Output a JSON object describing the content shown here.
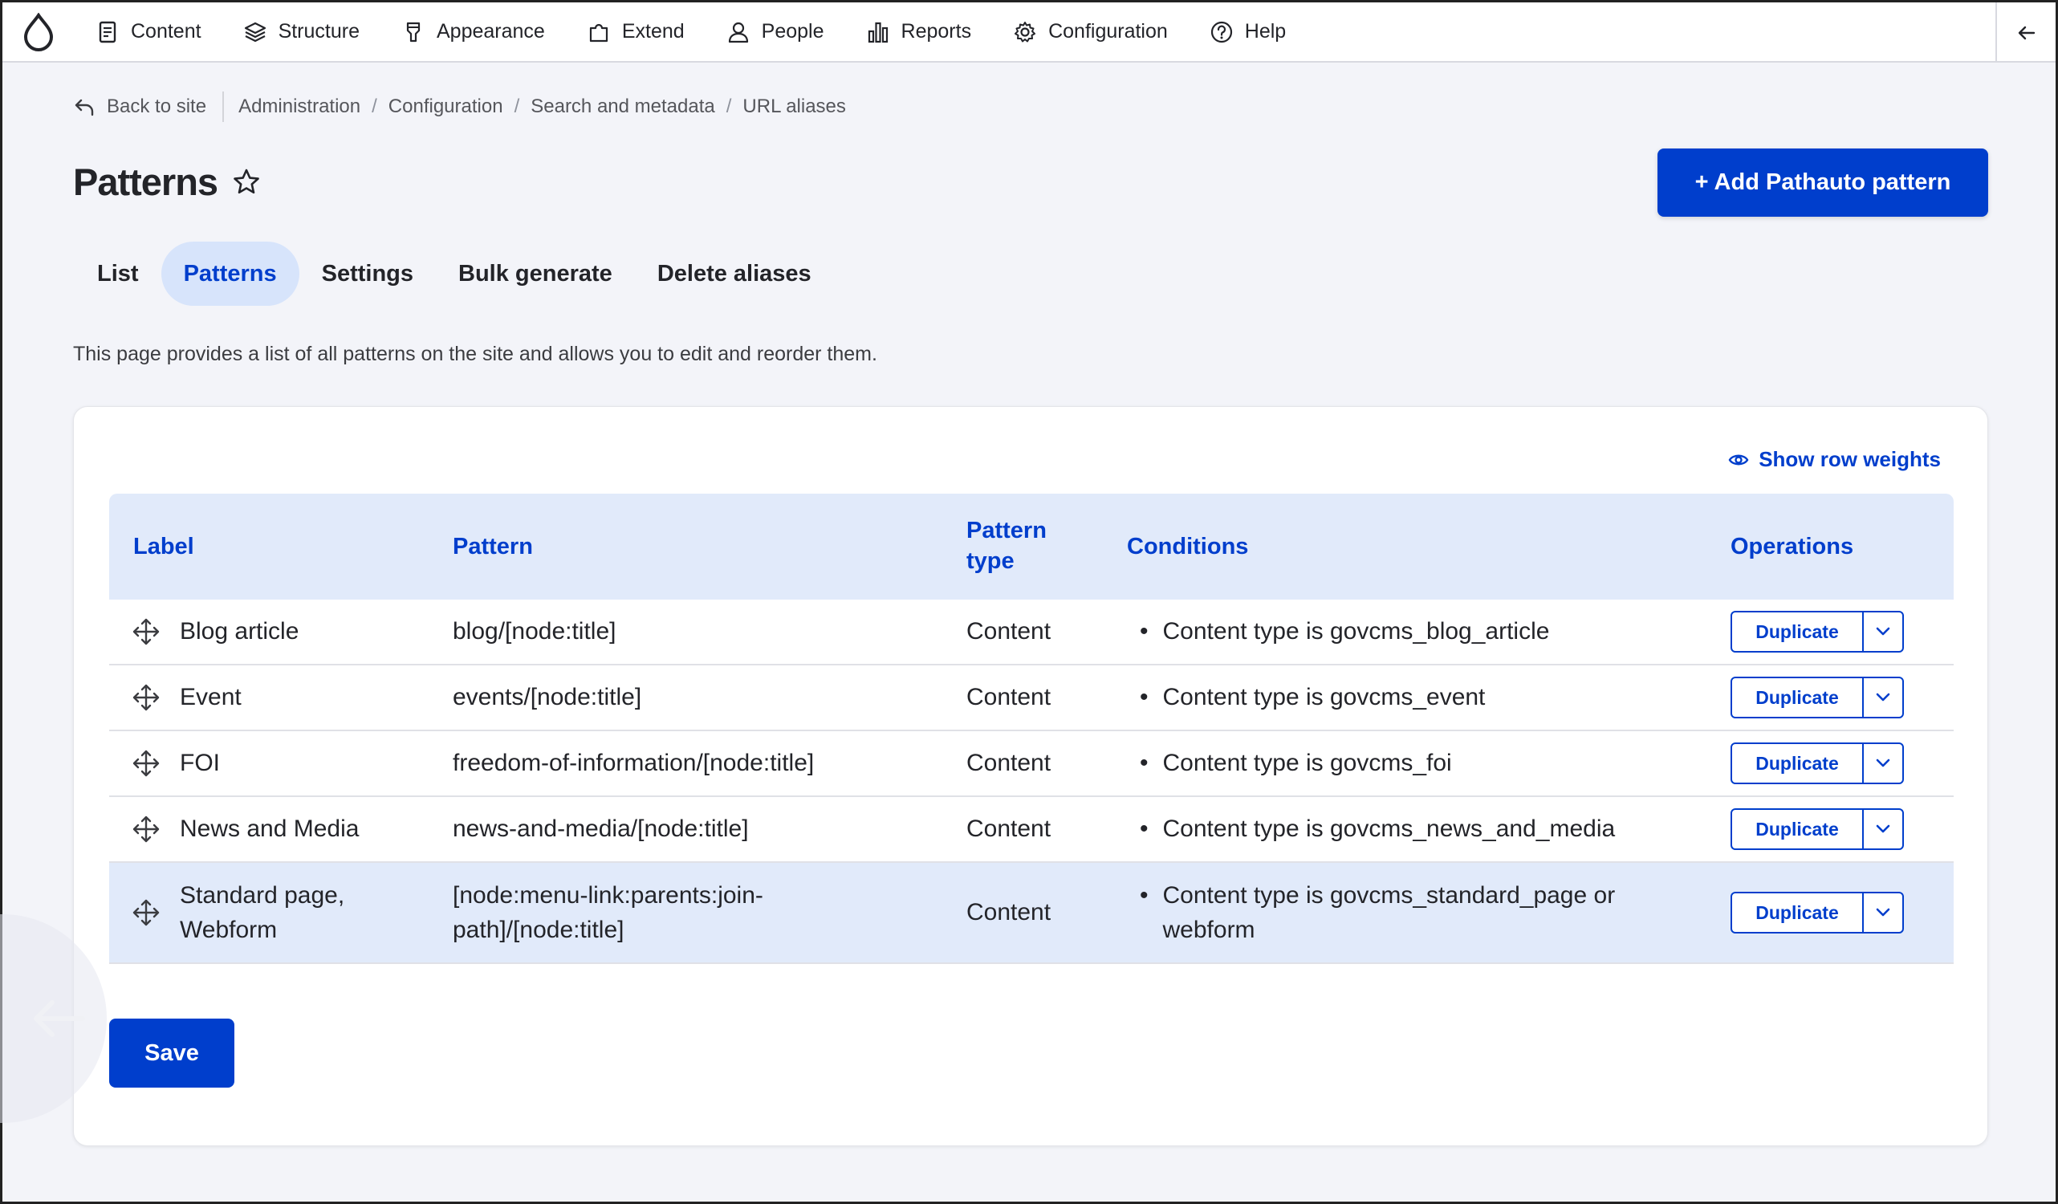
{
  "toolbar": {
    "items": [
      {
        "label": "Content",
        "icon": "document-icon"
      },
      {
        "label": "Structure",
        "icon": "layers-icon"
      },
      {
        "label": "Appearance",
        "icon": "brush-icon"
      },
      {
        "label": "Extend",
        "icon": "puzzle-icon"
      },
      {
        "label": "People",
        "icon": "person-icon"
      },
      {
        "label": "Reports",
        "icon": "bar-chart-icon"
      },
      {
        "label": "Configuration",
        "icon": "gear-icon"
      },
      {
        "label": "Help",
        "icon": "help-icon"
      }
    ]
  },
  "breadcrumb": {
    "back": "Back to site",
    "items": [
      "Administration",
      "Configuration",
      "Search and metadata",
      "URL aliases"
    ]
  },
  "page": {
    "title": "Patterns",
    "add_button": "+ Add Pathauto pattern",
    "description": "This page provides a list of all patterns on the site and allows you to edit and reorder them."
  },
  "tabs": [
    "List",
    "Patterns",
    "Settings",
    "Bulk generate",
    "Delete aliases"
  ],
  "active_tab": "Patterns",
  "table": {
    "show_weights": "Show row weights",
    "headers": {
      "label": "Label",
      "pattern": "Pattern",
      "type_line1": "Pattern",
      "type_line2": "type",
      "conditions": "Conditions",
      "operations": "Operations"
    },
    "rows": [
      {
        "label": "Blog article",
        "pattern": "blog/[node:title]",
        "type": "Content",
        "condition": "Content type is govcms_blog_article",
        "operation": "Duplicate"
      },
      {
        "label": "Event",
        "pattern": "events/[node:title]",
        "type": "Content",
        "condition": "Content type is govcms_event",
        "operation": "Duplicate"
      },
      {
        "label": "FOI",
        "pattern": "freedom-of-information/[node:title]",
        "type": "Content",
        "condition": "Content type is govcms_foi",
        "operation": "Duplicate"
      },
      {
        "label": "News and Media",
        "pattern": "news-and-media/[node:title]",
        "type": "Content",
        "condition": "Content type is govcms_news_and_media",
        "operation": "Duplicate"
      },
      {
        "label_line1": "Standard page,",
        "label_line2": "Webform",
        "pattern_line1": "[node:menu-link:parents:join-",
        "pattern_line2": "path]/[node:title]",
        "type": "Content",
        "condition_line1": "Content type is govcms_standard_page or",
        "condition_line2": "webform",
        "operation": "Duplicate"
      }
    ]
  },
  "save_button": "Save",
  "colors": {
    "accent": "#003ecc",
    "header_bg": "#e1eafa",
    "active_tab_bg": "#d7e4fb"
  }
}
